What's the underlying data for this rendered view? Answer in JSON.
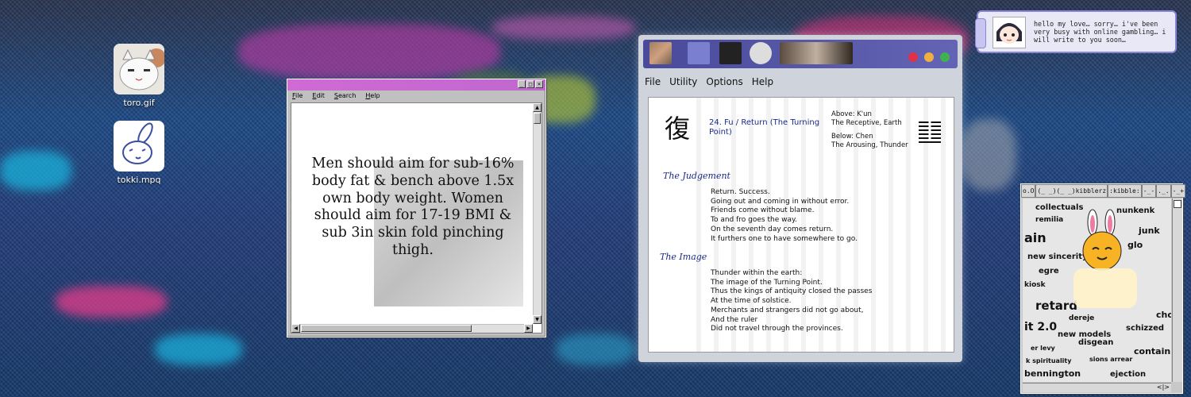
{
  "desktop": {
    "icons": [
      {
        "label": "toro.gif",
        "icon": "cat-face-icon"
      },
      {
        "label": "tokki.mpq",
        "icon": "rabbit-icon"
      }
    ]
  },
  "notepad": {
    "menu": [
      "File",
      "Edit",
      "Search",
      "Help"
    ],
    "buttons": [
      "_",
      "□",
      "×"
    ],
    "body_text": "Men should aim for sub-16% body fat & bench above 1.5x own body weight. Women should aim for 17-19 BMI & sub 3in skin fold pinching thigh."
  },
  "iching": {
    "menu": [
      "File",
      "Utility",
      "Options",
      "Help"
    ],
    "character": "復",
    "title": "24. Fu / Return (The Turning Point)",
    "above": "Above: K'un",
    "above_desc": "The Receptive, Earth",
    "below": "Below: Chen",
    "below_desc": "The Arousing, Thunder",
    "judgement_heading": "The Judgement",
    "judgement_lines": [
      "Return. Success.",
      "Going out and coming in without error.",
      "Friends come without blame.",
      "To and fro goes the way.",
      "On the seventh day comes return.",
      "It furthers one to have somewhere to go."
    ],
    "image_heading": "The Image",
    "image_lines": [
      "Thunder within the earth:",
      "The image of the Turning Point.",
      "Thus the kings of antiquity closed the passes",
      "At the time of solstice.",
      "Merchants and strangers did not go about,",
      "And the ruler",
      "Did not travel through the provinces."
    ]
  },
  "message": {
    "text": "hello my love… sorry… i've been very busy with online gambling… i will write to you soon…"
  },
  "kibblerz": {
    "title_parts": [
      "o.O",
      "(_ _)(_ _)kibblerz",
      ":kibble:",
      "-_-",
      "._.",
      "-_+"
    ],
    "words": [
      "collectuals",
      "remilia",
      "junk",
      "ain",
      "new sincerity",
      "egre",
      "kiosk",
      "retard",
      "it 2.0",
      "dereje",
      "new models",
      "er levy",
      "k spirituality",
      "bennington",
      "ejection",
      "nunkenk",
      "glo",
      "chopped",
      "schizzed",
      "disgean",
      "contain",
      "sions arrear"
    ]
  }
}
